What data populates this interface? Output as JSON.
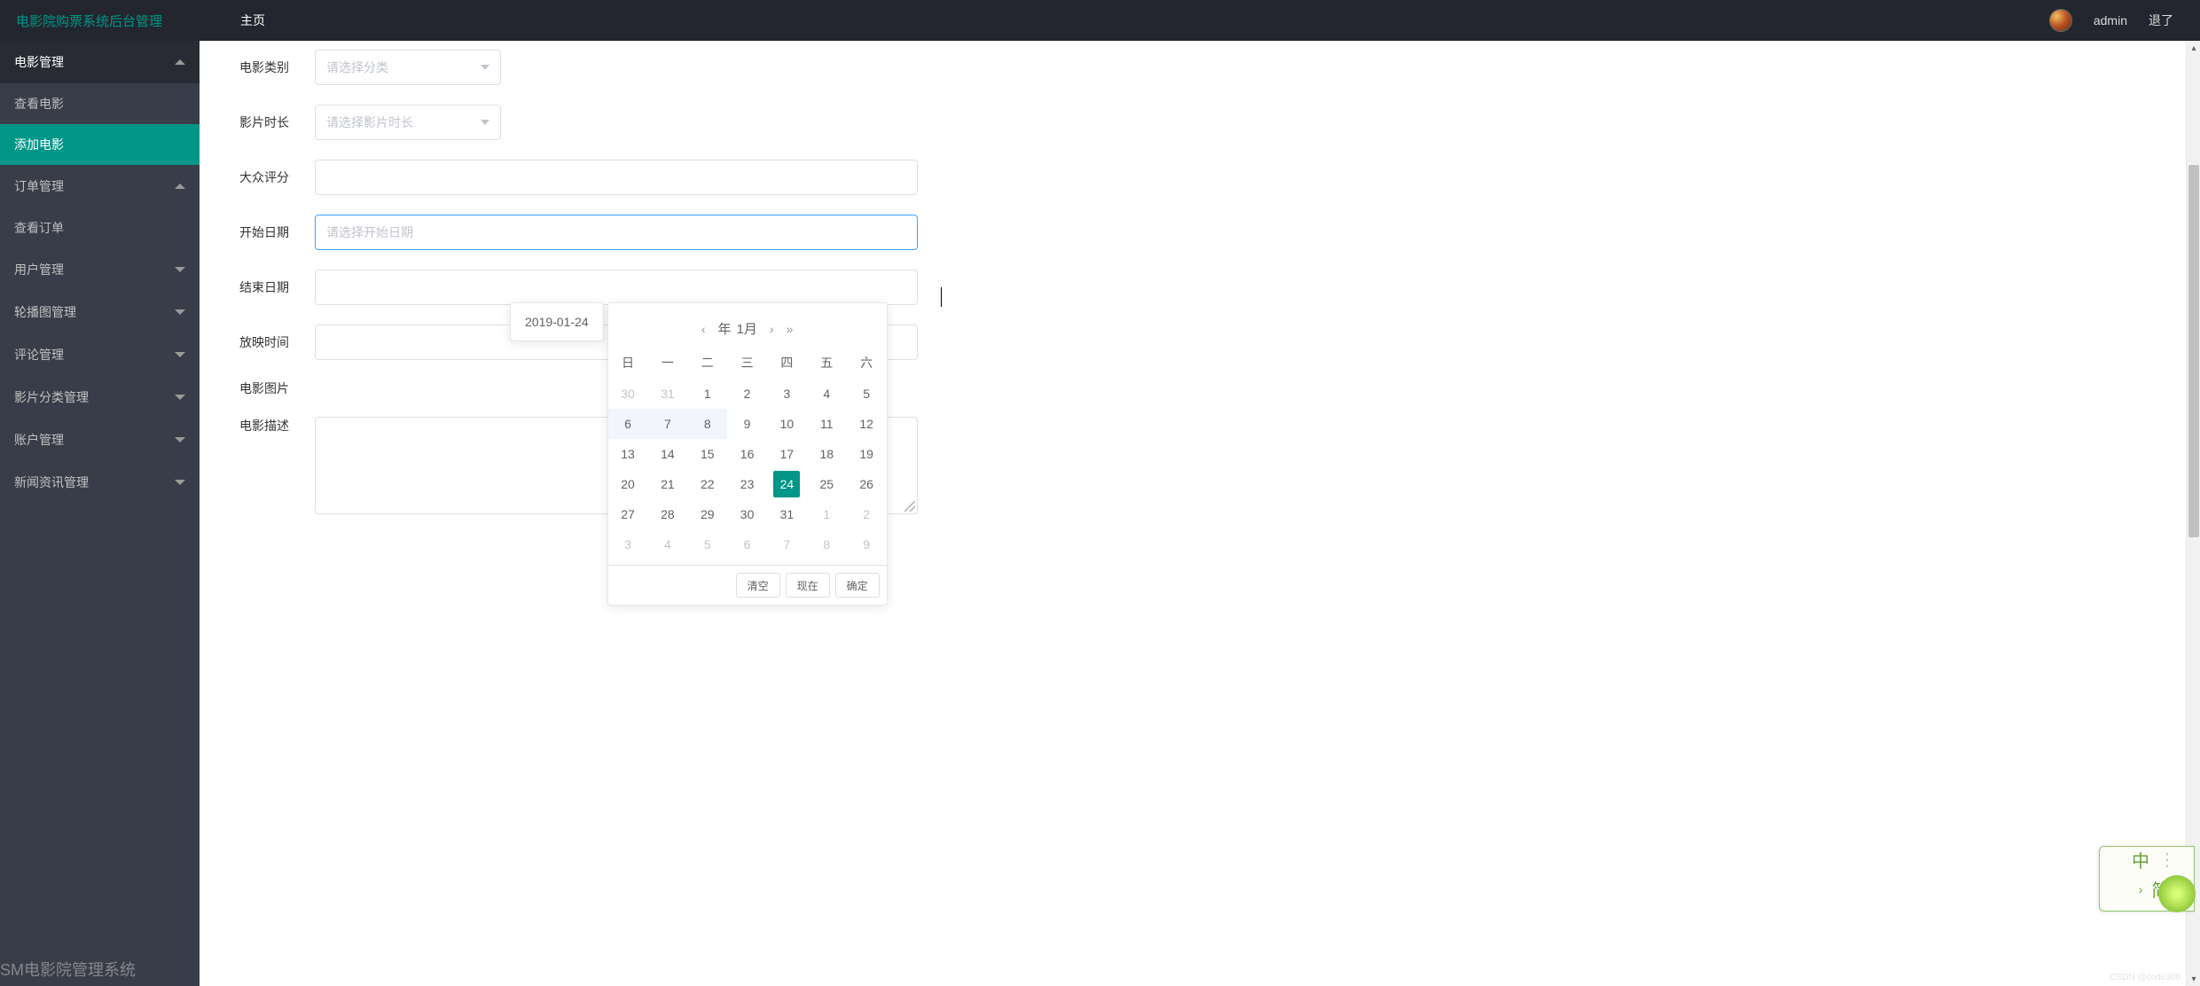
{
  "header": {
    "brand": "电影院购票系统后台管理",
    "nav_home": "主页",
    "username": "admin",
    "logout": "退了"
  },
  "sidebar": {
    "groups": [
      {
        "title": "电影管理",
        "expanded": true,
        "items": [
          {
            "label": "查看电影",
            "active": false
          },
          {
            "label": "添加电影",
            "active": true
          }
        ]
      },
      {
        "title": "订单管理",
        "expanded": true,
        "items": [
          {
            "label": "查看订单",
            "active": false
          }
        ]
      },
      {
        "title": "用户管理",
        "expanded": false,
        "items": []
      },
      {
        "title": "轮播图管理",
        "expanded": false,
        "items": []
      },
      {
        "title": "评论管理",
        "expanded": false,
        "items": []
      },
      {
        "title": "影片分类管理",
        "expanded": false,
        "items": []
      },
      {
        "title": "账户管理",
        "expanded": false,
        "items": []
      },
      {
        "title": "新闻资讯管理",
        "expanded": false,
        "items": []
      }
    ]
  },
  "form": {
    "category_label": "电影类别",
    "category_placeholder": "请选择分类",
    "duration_label": "影片时长",
    "duration_placeholder": "请选择影片时长",
    "rating_label": "大众评分",
    "start_date_label": "开始日期",
    "start_date_placeholder": "请选择开始日期",
    "end_date_label": "结束日期",
    "showtime_label": "放映时间",
    "poster_label": "电影图片",
    "desc_label": "电影描述"
  },
  "datepicker": {
    "tooltip_value": "2019-01-24",
    "year_suffix": "年",
    "month_label": "1月",
    "weekdays": [
      "日",
      "一",
      "二",
      "三",
      "四",
      "五",
      "六"
    ],
    "rows": [
      [
        {
          "d": "30",
          "o": true
        },
        {
          "d": "31",
          "o": true
        },
        {
          "d": "1"
        },
        {
          "d": "2"
        },
        {
          "d": "3"
        },
        {
          "d": "4"
        },
        {
          "d": "5"
        }
      ],
      [
        {
          "d": "6",
          "h": true
        },
        {
          "d": "7",
          "h": true
        },
        {
          "d": "8",
          "h": true
        },
        {
          "d": "9"
        },
        {
          "d": "10"
        },
        {
          "d": "11"
        },
        {
          "d": "12"
        }
      ],
      [
        {
          "d": "13"
        },
        {
          "d": "14"
        },
        {
          "d": "15"
        },
        {
          "d": "16"
        },
        {
          "d": "17"
        },
        {
          "d": "18"
        },
        {
          "d": "19"
        }
      ],
      [
        {
          "d": "20"
        },
        {
          "d": "21"
        },
        {
          "d": "22"
        },
        {
          "d": "23"
        },
        {
          "d": "24",
          "today": true
        },
        {
          "d": "25"
        },
        {
          "d": "26"
        }
      ],
      [
        {
          "d": "27"
        },
        {
          "d": "28"
        },
        {
          "d": "29"
        },
        {
          "d": "30"
        },
        {
          "d": "31"
        },
        {
          "d": "1",
          "o": true
        },
        {
          "d": "2",
          "o": true
        }
      ],
      [
        {
          "d": "3",
          "o": true
        },
        {
          "d": "4",
          "o": true
        },
        {
          "d": "5",
          "o": true
        },
        {
          "d": "6",
          "o": true
        },
        {
          "d": "7",
          "o": true
        },
        {
          "d": "8",
          "o": true
        },
        {
          "d": "9",
          "o": true
        }
      ]
    ],
    "clear_btn": "清空",
    "now_btn": "现在",
    "confirm_btn": "确定"
  },
  "ime": {
    "mode": "中",
    "sub": "简"
  },
  "footer_text": "SM电影院管理系统",
  "watermark": "CSDN @code306"
}
